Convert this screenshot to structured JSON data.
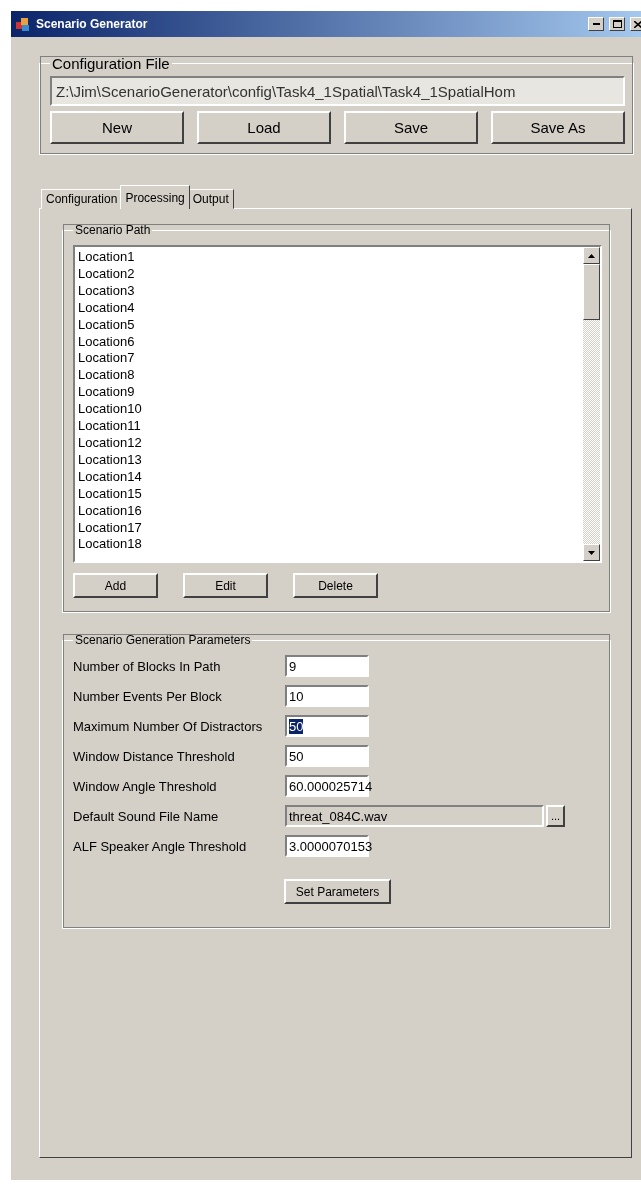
{
  "window": {
    "title": "Scenario Generator"
  },
  "configuration_file": {
    "label": "Configuration File",
    "path": "Z:\\Jim\\ScenarioGenerator\\config\\Task4_1Spatial\\Task4_1SpatialHom",
    "buttons": [
      "New",
      "Load",
      "Save",
      "Save As"
    ]
  },
  "tabs": [
    {
      "label": "Configuration",
      "selected": false
    },
    {
      "label": "Processing",
      "selected": true
    },
    {
      "label": "Output",
      "selected": false
    }
  ],
  "scenario_path": {
    "label": "Scenario Path",
    "items": [
      "Location1",
      "Location2",
      "Location3",
      "Location4",
      "Location5",
      "Location6",
      "Location7",
      "Location8",
      "Location9",
      "Location10",
      "Location11",
      "Location12",
      "Location13",
      "Location14",
      "Location15",
      "Location16",
      "Location17",
      "Location18"
    ],
    "buttons": [
      "Add",
      "Edit",
      "Delete"
    ]
  },
  "parameters": {
    "label": "Scenario Generation Parameters",
    "fields": [
      {
        "label": "Number of Blocks In Path",
        "value": "9",
        "kind": "text",
        "selected": false
      },
      {
        "label": "Number Events Per Block",
        "value": "10",
        "kind": "text",
        "selected": false
      },
      {
        "label": "Maximum Number Of Distractors",
        "value": "50",
        "kind": "text",
        "selected": true
      },
      {
        "label": "Window Distance Threshold",
        "value": "50",
        "kind": "text",
        "selected": false
      },
      {
        "label": "Window Angle Threshold",
        "value": "60.000025714",
        "kind": "text",
        "selected": false
      },
      {
        "label": "Default Sound File Name",
        "value": "threat_084C.wav",
        "kind": "file",
        "selected": false,
        "browse": "..."
      },
      {
        "label": "ALF Speaker Angle Threshold",
        "value": "3.0000070153",
        "kind": "text",
        "selected": false
      }
    ],
    "button": "Set Parameters"
  }
}
